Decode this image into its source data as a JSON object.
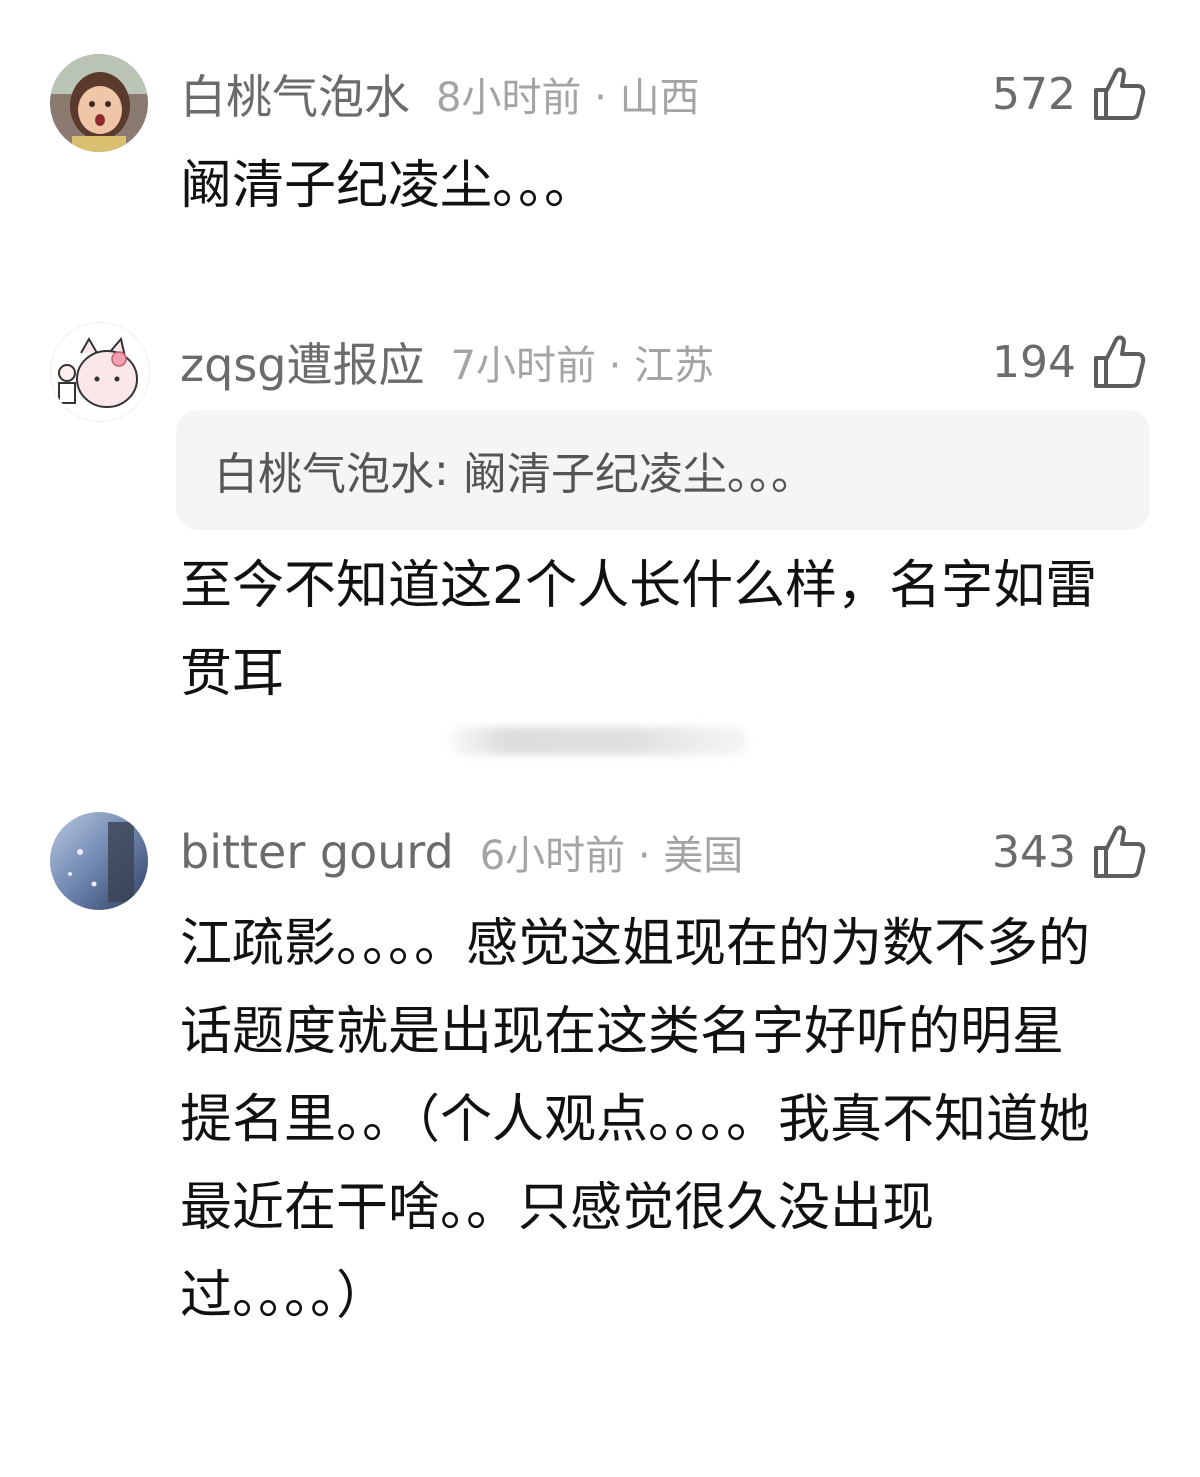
{
  "comments": [
    {
      "username": "白桃气泡水",
      "meta": "8小时前 · 山西",
      "likes": "572",
      "text": "阚清子纪凌尘。。。",
      "avatar_icon": "girl-photo-avatar"
    },
    {
      "username": "zqsg遭报应",
      "meta": "7小时前 · 江苏",
      "likes": "194",
      "quote_author": "白桃气泡水",
      "quote_text": "阚清子纪凌尘。。。",
      "text": "至今不知道这2个人长什么样，名字如雷贯耳",
      "avatar_icon": "cartoon-cat-avatar"
    },
    {
      "username": "bitter gourd",
      "meta": "6小时前 · 美国",
      "likes": "343",
      "text": "江疏影。。。。感觉这姐现在的为数不多的话题度就是出现在这类名字好听的明星提名里。。（个人观点。。。。我真不知道她最近在干啥。。只感觉很久没出现过。。。。）",
      "avatar_icon": "blue-photo-avatar"
    }
  ],
  "icons": {
    "like": "thumbs-up-icon"
  },
  "colors": {
    "username": "#6b6b6b",
    "meta": "#a4a4a4",
    "quote_bg": "#f5f5f5",
    "text": "#111111"
  }
}
